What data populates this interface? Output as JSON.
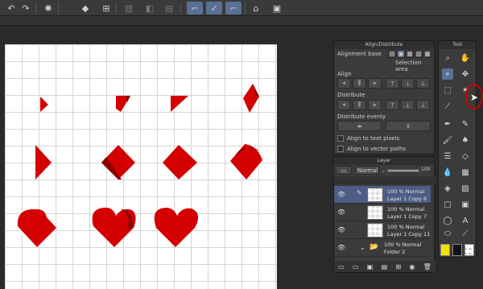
{
  "toolbar": {
    "icons": [
      "rotate-left-icon",
      "rotate-right-icon",
      "loading-icon",
      "fill-icon",
      "crop-icon",
      "disabled-a-icon",
      "disabled-b-icon",
      "disabled-c-icon",
      "stroke-a-icon",
      "stroke-b-icon",
      "stroke-c-icon",
      "3d-icon",
      "edit-icon"
    ]
  },
  "align_panel": {
    "title": "Align/Distribute",
    "alignment_base_label": "Alignment base",
    "selection_area": "Selection area",
    "align_label": "Align",
    "distribute_label": "Distribute",
    "distribute_evenly_label": "Distribute evenly",
    "align_text_pixels": "Align to text pixels",
    "align_vector_paths": "Align to vector paths"
  },
  "layer_panel": {
    "title": "Layer",
    "blend_mode": "Normal",
    "opacity": "100",
    "layers": [
      {
        "line1": "100 % Normal",
        "line2": "Layer 1 Copy 6",
        "selected": true
      },
      {
        "line1": "100 % Normal",
        "line2": "Layer 1 Copy 7",
        "selected": false
      },
      {
        "line1": "100 % Normal",
        "line2": "Layer 1 Copy 11",
        "selected": false
      },
      {
        "line1": "100 % Normal",
        "line2": "Folder 2",
        "selected": false
      }
    ]
  },
  "tool_panel": {
    "title": "Tool",
    "colors": {
      "main": "#f0e300",
      "sub": "#111111",
      "accent": "#4d5d86"
    }
  }
}
